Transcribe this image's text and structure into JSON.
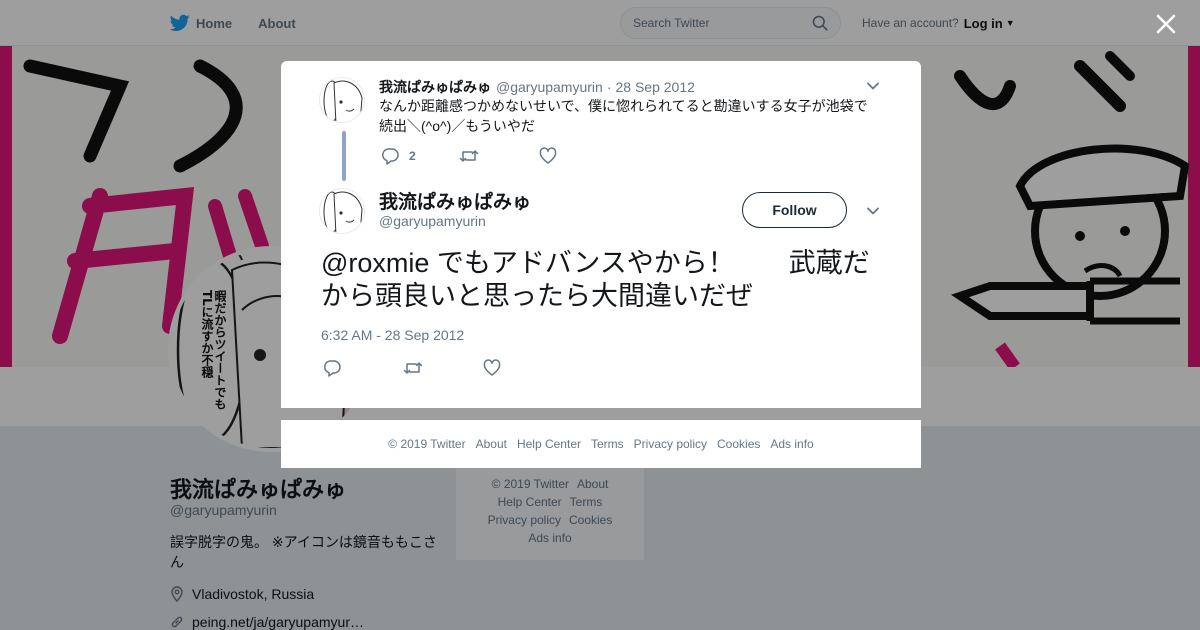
{
  "nav": {
    "home_label": "Home",
    "about_label": "About"
  },
  "search": {
    "placeholder": "Search Twitter"
  },
  "account": {
    "prompt": "Have an account?",
    "login_label": "Log in"
  },
  "profile": {
    "name": "我流ぱみゅぱみゅ",
    "handle": "@garyupamyurin",
    "bio": "誤字脱字の鬼。 ※アイコンは鏡音ももこさん",
    "location": "Vladivostok, Russia",
    "link": "peing.net/ja/garyupamyur…",
    "avatar_speech": "暇だからツイートでもTLに流すか不穏"
  },
  "parent_tweet": {
    "name": "我流ぱみゅぱみゅ",
    "handle": "@garyupamyurin",
    "separator": "·",
    "date": "28 Sep 2012",
    "text": "なんか距離感つかめないせいで、僕に惚れられてると勘違いする女子が池袋で続出＼(^o^)／もういやだ",
    "reply_count": "2"
  },
  "main_tweet": {
    "name": "我流ぱみゅぱみゅ",
    "handle": "@garyupamyurin",
    "follow_label": "Follow",
    "text": "@roxmie でもアドバンスやから！　　武蔵だから頭良いと思ったら大間違いだぜ",
    "timestamp": "6:32 AM - 28 Sep 2012"
  },
  "modal_footer": [
    "© 2019 Twitter",
    "About",
    "Help Center",
    "Terms",
    "Privacy policy",
    "Cookies",
    "Ads info"
  ],
  "side_footer": [
    "© 2019 Twitter",
    "About",
    "Help Center",
    "Terms",
    "Privacy policy",
    "Cookies",
    "Ads info"
  ],
  "colors": {
    "twitter_blue": "#1da1f2",
    "banner_pink": "#e0157a",
    "overlay": "rgba(0,0,0,0.38)",
    "thread_line": "#8fa4c6"
  },
  "icons": [
    "twitter-bird-icon",
    "search-icon",
    "close-icon",
    "chevron-down-icon",
    "reply-icon",
    "retweet-icon",
    "like-icon",
    "location-icon",
    "link-icon"
  ]
}
